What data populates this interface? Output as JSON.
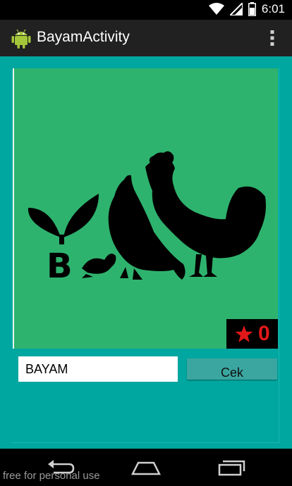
{
  "status_bar": {
    "time": "6:01",
    "icons": [
      "wifi-icon",
      "signal-icon",
      "battery-icon"
    ]
  },
  "action_bar": {
    "title": "BayamActivity",
    "icon": "android-icon",
    "menu_icon": "overflow-menu-icon"
  },
  "puzzle": {
    "image_description_icon": "chicken-silhouette-image",
    "image_letter": "B",
    "score": "0",
    "score_icon": "star-icon"
  },
  "answer": {
    "value": "BAYAM",
    "button_label": "Cek"
  },
  "nav_bar": {
    "icons": [
      "back-icon",
      "home-icon",
      "recents-icon"
    ]
  },
  "watermark": "free for personal use",
  "colors": {
    "background": "#00a6a0",
    "image_bg": "#2eb36e",
    "action_bar": "#212121",
    "score_color": "#e01818",
    "button": "#3ba6a0"
  }
}
